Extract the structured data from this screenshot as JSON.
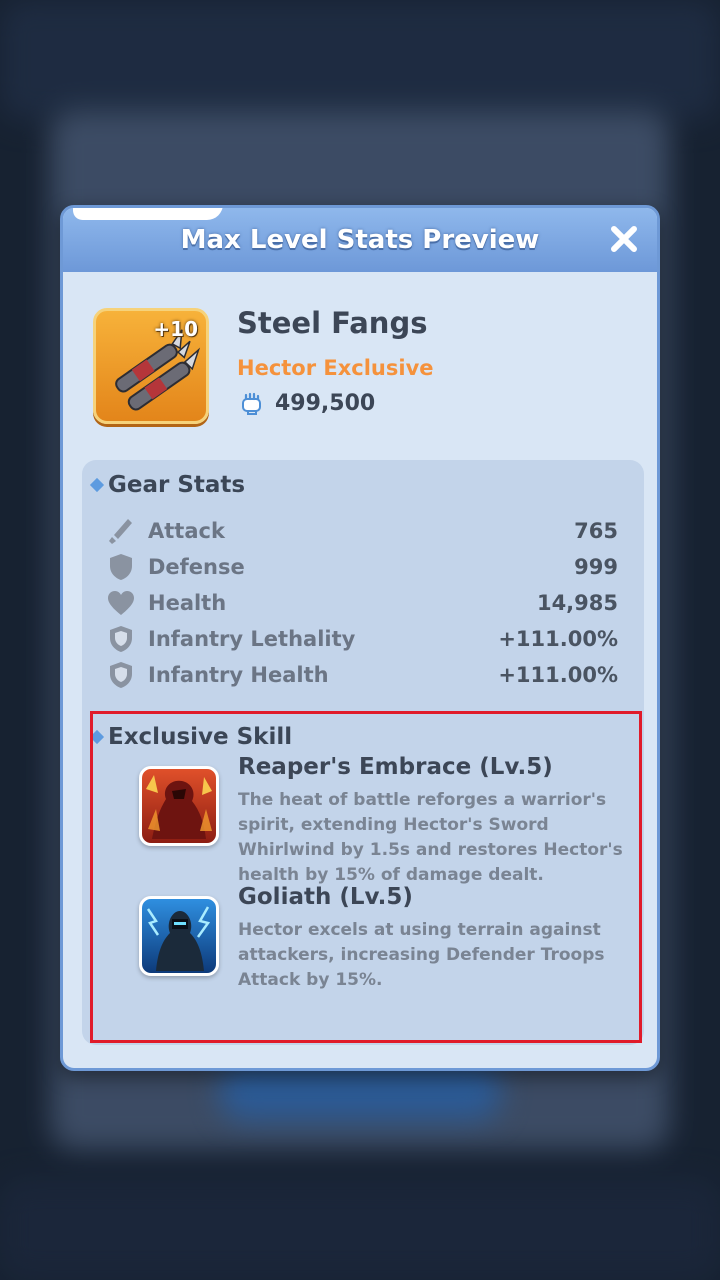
{
  "modal": {
    "title": "Max Level Stats Preview",
    "close_icon": "close-x-icon"
  },
  "item": {
    "name": "Steel Fangs",
    "level_badge": "+10",
    "subtitle": "Hector Exclusive",
    "power_icon": "fist-icon",
    "power": "499,500"
  },
  "gear_stats": {
    "heading": "Gear Stats",
    "rows": [
      {
        "icon": "sword-icon",
        "label": "Attack",
        "value": "765"
      },
      {
        "icon": "shield-icon",
        "label": "Defense",
        "value": "999"
      },
      {
        "icon": "heart-icon",
        "label": "Health",
        "value": "14,985"
      },
      {
        "icon": "badge-shield-icon",
        "label": "Infantry Lethality",
        "value": "+111.00%"
      },
      {
        "icon": "badge-shield-icon",
        "label": "Infantry Health",
        "value": "+111.00%"
      }
    ]
  },
  "exclusive_skill": {
    "heading": "Exclusive Skill",
    "skills": [
      {
        "icon": "reaper-skill-icon",
        "name": "Reaper's Embrace (Lv.5)",
        "description": "The heat of battle reforges a warrior's spirit, extending Hector's Sword Whirlwind by 1.5s and restores Hector's health by 15% of damage dealt."
      },
      {
        "icon": "goliath-skill-icon",
        "name": "Goliath (Lv.5)",
        "description": "Hector excels at using terrain against attackers, increasing Defender Troops Attack by 15%."
      }
    ]
  },
  "colors": {
    "accent_orange": "#f5923c",
    "header_blue": "#6d98d8",
    "highlight_red": "#e01b2a"
  }
}
